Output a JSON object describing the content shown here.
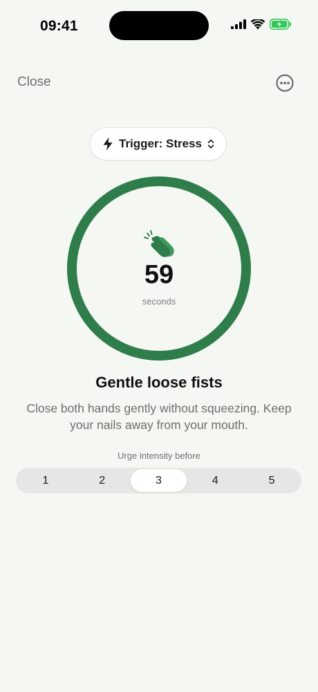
{
  "status_bar": {
    "time": "09:41"
  },
  "header": {
    "close_label": "Close",
    "more_icon": "ellipsis-circle-icon"
  },
  "trigger": {
    "label": "Trigger: Stress",
    "icon": "bolt-icon",
    "chevron_icon": "chevron-up-down-icon"
  },
  "timer": {
    "icon": "clapping-hands-icon",
    "value": "59",
    "unit": "seconds",
    "ring_color": "#2f7d4a",
    "progress": 1.0
  },
  "exercise": {
    "title": "Gentle loose fists",
    "description": "Close both hands gently without squeezing. Keep your nails away from your mouth."
  },
  "urge": {
    "label": "Urge intensity before",
    "options": [
      "1",
      "2",
      "3",
      "4",
      "5"
    ],
    "selected": "3"
  },
  "colors": {
    "accent": "#2f7d4a",
    "background": "#f4f7f2"
  }
}
